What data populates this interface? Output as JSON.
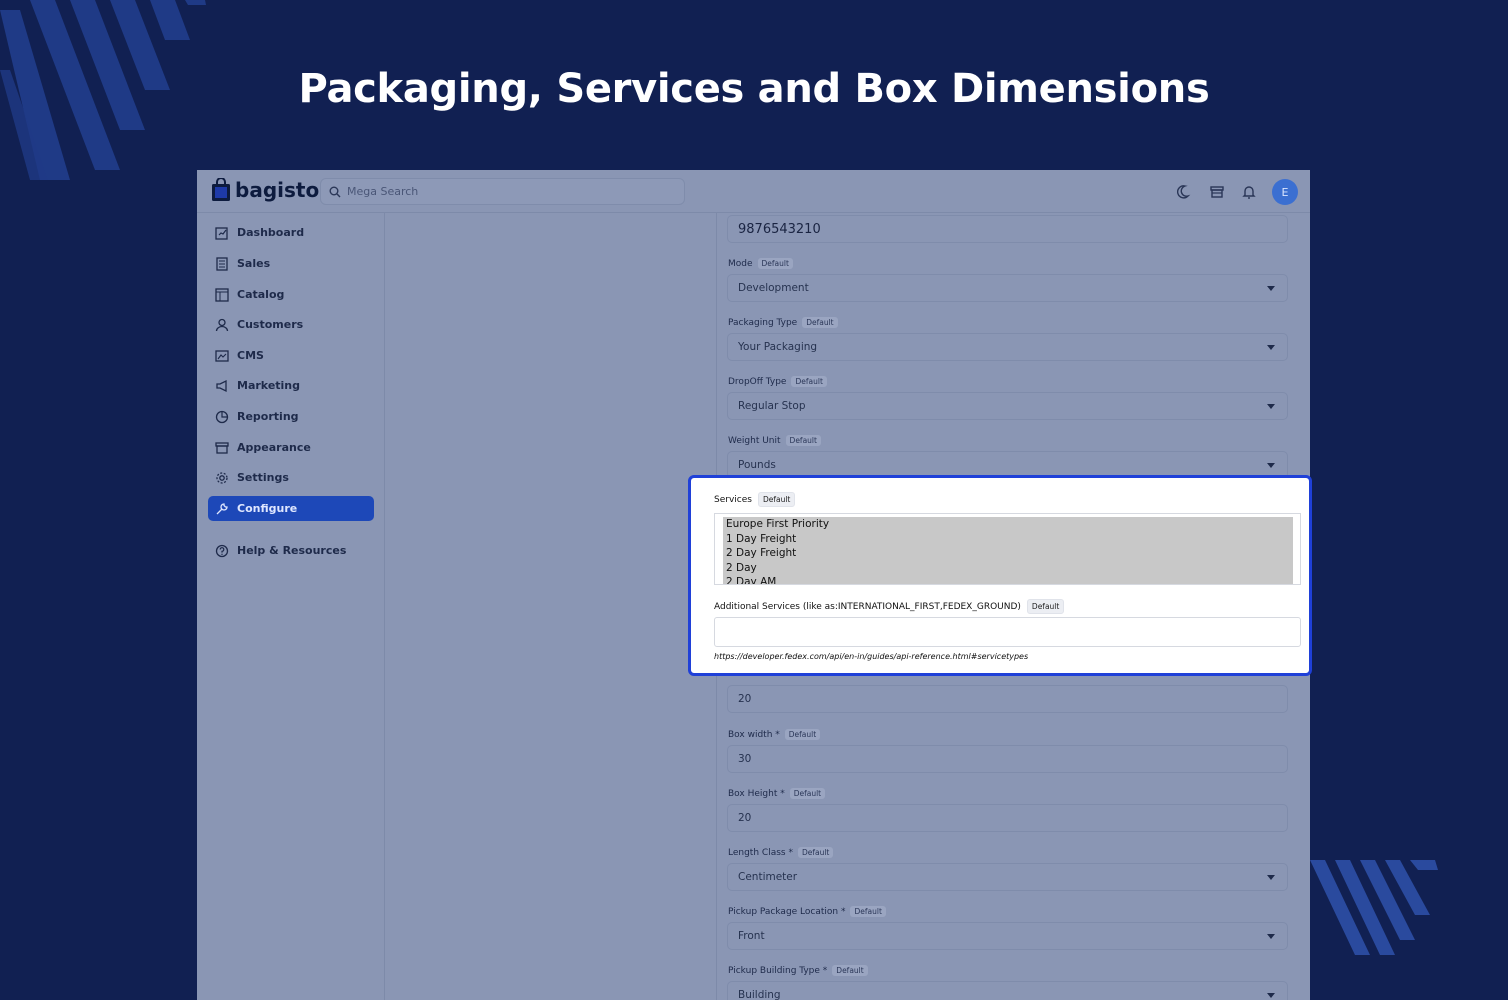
{
  "headline": "Packaging, Services and Box Dimensions",
  "app": {
    "logo_text": "bagisto",
    "search_placeholder": "Mega Search",
    "avatar_initial": "E"
  },
  "sidebar": {
    "items": [
      {
        "label": "Dashboard",
        "icon": "dashboard-icon"
      },
      {
        "label": "Sales",
        "icon": "sales-icon"
      },
      {
        "label": "Catalog",
        "icon": "catalog-icon"
      },
      {
        "label": "Customers",
        "icon": "customers-icon"
      },
      {
        "label": "CMS",
        "icon": "cms-icon"
      },
      {
        "label": "Marketing",
        "icon": "marketing-icon"
      },
      {
        "label": "Reporting",
        "icon": "reporting-icon"
      },
      {
        "label": "Appearance",
        "icon": "appearance-icon"
      },
      {
        "label": "Settings",
        "icon": "settings-icon"
      },
      {
        "label": "Configure",
        "icon": "configure-icon",
        "active": true
      },
      {
        "label": "Help & Resources",
        "icon": "help-icon"
      }
    ]
  },
  "form": {
    "phone_value": "9876543210",
    "default_badge": "Default",
    "mode": {
      "label": "Mode",
      "value": "Development"
    },
    "packaging_type": {
      "label": "Packaging Type",
      "value": "Your Packaging"
    },
    "dropoff_type": {
      "label": "DropOff Type",
      "value": "Regular Stop"
    },
    "weight_unit": {
      "label": "Weight Unit",
      "value": "Pounds"
    },
    "box_length": {
      "value": "20"
    },
    "box_width": {
      "label": "Box width *",
      "value": "30"
    },
    "box_height": {
      "label": "Box Height *",
      "value": "20"
    },
    "length_class": {
      "label": "Length Class *",
      "value": "Centimeter"
    },
    "pickup_location": {
      "label": "Pickup Package Location *",
      "value": "Front"
    },
    "pickup_building": {
      "label": "Pickup Building Type *",
      "value": "Building"
    }
  },
  "popup": {
    "services_label": "Services",
    "default_badge": "Default",
    "services_options": [
      "Europe First Priority",
      "1 Day Freight",
      "2 Day Freight",
      "2 Day",
      "2 Day AM"
    ],
    "additional_label": "Additional Services (like as:INTERNATIONAL_FIRST,FEDEX_GROUND)",
    "helper_link": "https://developer.fedex.com/api/en-in/guides/api-reference.html#servicetypes"
  },
  "colors": {
    "background": "#112052",
    "accent": "#1d48b8",
    "highlight_border": "#1f40d8"
  }
}
